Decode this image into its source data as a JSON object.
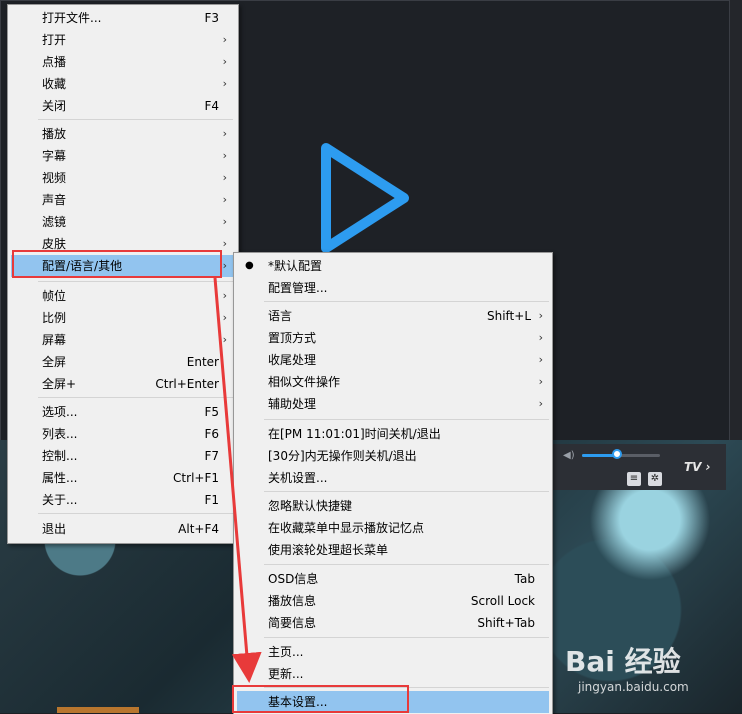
{
  "left_menu": {
    "items": [
      {
        "label": "打开文件...",
        "shortcut": "F3",
        "submenu": false
      },
      {
        "label": "打开",
        "shortcut": "",
        "submenu": true
      },
      {
        "label": "点播",
        "shortcut": "",
        "submenu": true
      },
      {
        "label": "收藏",
        "shortcut": "",
        "submenu": true
      },
      {
        "label": "关闭",
        "shortcut": "F4",
        "submenu": false
      },
      {
        "label": "播放",
        "shortcut": "",
        "submenu": true
      },
      {
        "label": "字幕",
        "shortcut": "",
        "submenu": true
      },
      {
        "label": "视频",
        "shortcut": "",
        "submenu": true
      },
      {
        "label": "声音",
        "shortcut": "",
        "submenu": true
      },
      {
        "label": "滤镜",
        "shortcut": "",
        "submenu": true
      },
      {
        "label": "皮肤",
        "shortcut": "",
        "submenu": true
      },
      {
        "label": "配置/语言/其他",
        "shortcut": "",
        "submenu": true
      },
      {
        "label": "帧位",
        "shortcut": "",
        "submenu": true
      },
      {
        "label": "比例",
        "shortcut": "",
        "submenu": true
      },
      {
        "label": "屏幕",
        "shortcut": "",
        "submenu": true
      },
      {
        "label": "全屏",
        "shortcut": "Enter",
        "submenu": false
      },
      {
        "label": "全屏+",
        "shortcut": "Ctrl+Enter",
        "submenu": false
      },
      {
        "label": "选项...",
        "shortcut": "F5",
        "submenu": false
      },
      {
        "label": "列表...",
        "shortcut": "F6",
        "submenu": false
      },
      {
        "label": "控制...",
        "shortcut": "F7",
        "submenu": false
      },
      {
        "label": "属性...",
        "shortcut": "Ctrl+F1",
        "submenu": false
      },
      {
        "label": "关于...",
        "shortcut": "F1",
        "submenu": false
      },
      {
        "label": "退出",
        "shortcut": "Alt+F4",
        "submenu": false
      }
    ],
    "highlighted": "配置/语言/其他"
  },
  "right_menu": {
    "items": [
      {
        "label": "*默认配置",
        "shortcut": "",
        "submenu": false,
        "checked": true
      },
      {
        "label": "配置管理...",
        "shortcut": "",
        "submenu": false
      },
      {
        "label": "语言",
        "shortcut": "Shift+L",
        "submenu": true
      },
      {
        "label": "置顶方式",
        "shortcut": "",
        "submenu": true
      },
      {
        "label": "收尾处理",
        "shortcut": "",
        "submenu": true
      },
      {
        "label": "相似文件操作",
        "shortcut": "",
        "submenu": true
      },
      {
        "label": "辅助处理",
        "shortcut": "",
        "submenu": true
      },
      {
        "label": "在[PM 11:01:01]时间关机/退出",
        "shortcut": "",
        "submenu": false
      },
      {
        "label": "[30分]内无操作则关机/退出",
        "shortcut": "",
        "submenu": false
      },
      {
        "label": "关机设置...",
        "shortcut": "",
        "submenu": false
      },
      {
        "label": "忽略默认快捷键",
        "shortcut": "",
        "submenu": false
      },
      {
        "label": "在收藏菜单中显示播放记忆点",
        "shortcut": "",
        "submenu": false
      },
      {
        "label": "使用滚轮处理超长菜单",
        "shortcut": "",
        "submenu": false
      },
      {
        "label": "OSD信息",
        "shortcut": "Tab",
        "submenu": false
      },
      {
        "label": "播放信息",
        "shortcut": "Scroll Lock",
        "submenu": false
      },
      {
        "label": "简要信息",
        "shortcut": "Shift+Tab",
        "submenu": false
      },
      {
        "label": "主页...",
        "shortcut": "",
        "submenu": false
      },
      {
        "label": "更新...",
        "shortcut": "",
        "submenu": false
      },
      {
        "label": "基本设置...",
        "shortcut": "",
        "submenu": false
      }
    ],
    "highlighted": "基本设置..."
  },
  "player": {
    "tv_label": "TV",
    "play_icon": "play-triangle-icon",
    "volume_fraction": 0.45
  },
  "watermark": {
    "brand": "Bai 经验",
    "sub": "jingyan.baidu.com"
  },
  "colors": {
    "accent": "#2d9cf0",
    "highlight": "#92c4ef",
    "annotation_red": "#e83a3a"
  }
}
